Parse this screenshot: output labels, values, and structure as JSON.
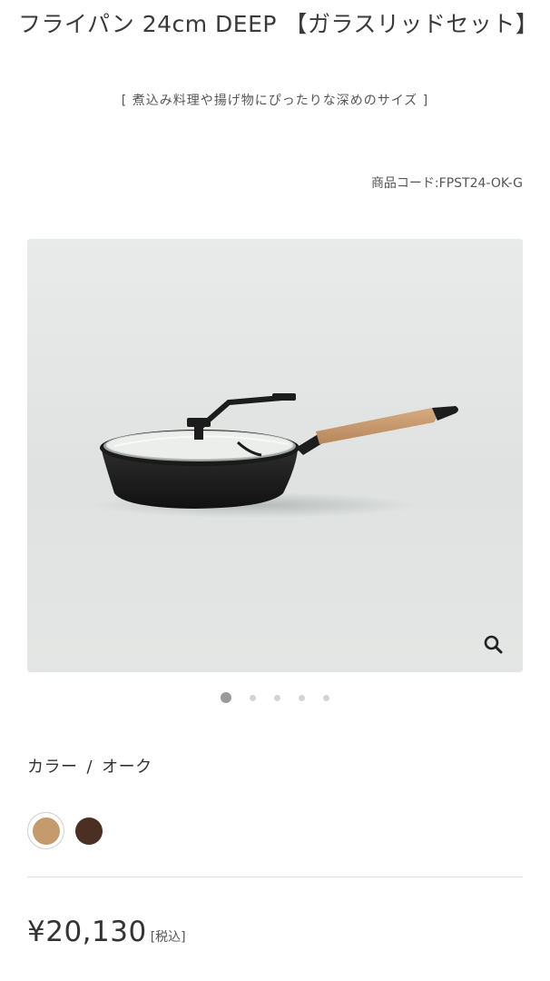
{
  "product": {
    "title": "フライパン 24cm DEEP 【ガラスリッドセット】",
    "subtitle": "[ 煮込み料理や揚げ物にぴったりな深めのサイズ ]",
    "code": "商品コード:FPST24-OK-G"
  },
  "gallery": {
    "image_alt": "フライパン 24cm DEEP ガラスリッド",
    "zoom_icon": "search-icon",
    "slide_count": 5,
    "active_slide": 1
  },
  "color": {
    "label": "カラー",
    "separator": "/",
    "selected": "オーク",
    "swatches": [
      {
        "name": "oak",
        "hex": "#c59a6c",
        "selected": true
      },
      {
        "name": "walnut",
        "hex": "#4a2f22",
        "selected": false
      }
    ]
  },
  "price": {
    "amount": "¥20,130",
    "tax_label": "[税込]"
  }
}
